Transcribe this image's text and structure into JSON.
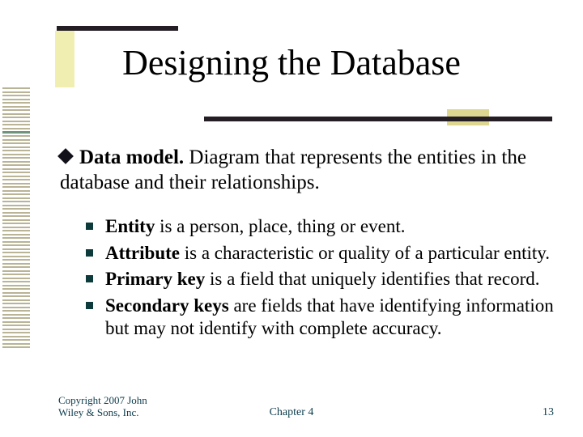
{
  "title": "Designing the Database",
  "main": {
    "bold": "Data model.",
    "rest": " Diagram that represents the entities in the database and their relationships."
  },
  "subs": [
    {
      "bold": "Entity",
      "rest": " is a person, place, thing or event."
    },
    {
      "bold": "Attribute",
      "rest": " is a characteristic or quality of a particular entity."
    },
    {
      "bold": "Primary key",
      "rest": " is a field that uniquely identifies that record."
    },
    {
      "bold": "Secondary keys",
      "rest": " are fields that have identifying information but may not identify with complete accuracy."
    }
  ],
  "footer": {
    "copyright_l1": "Copyright 2007 John",
    "copyright_l2": "Wiley & Sons, Inc.",
    "chapter": "Chapter 4",
    "page": "13"
  }
}
